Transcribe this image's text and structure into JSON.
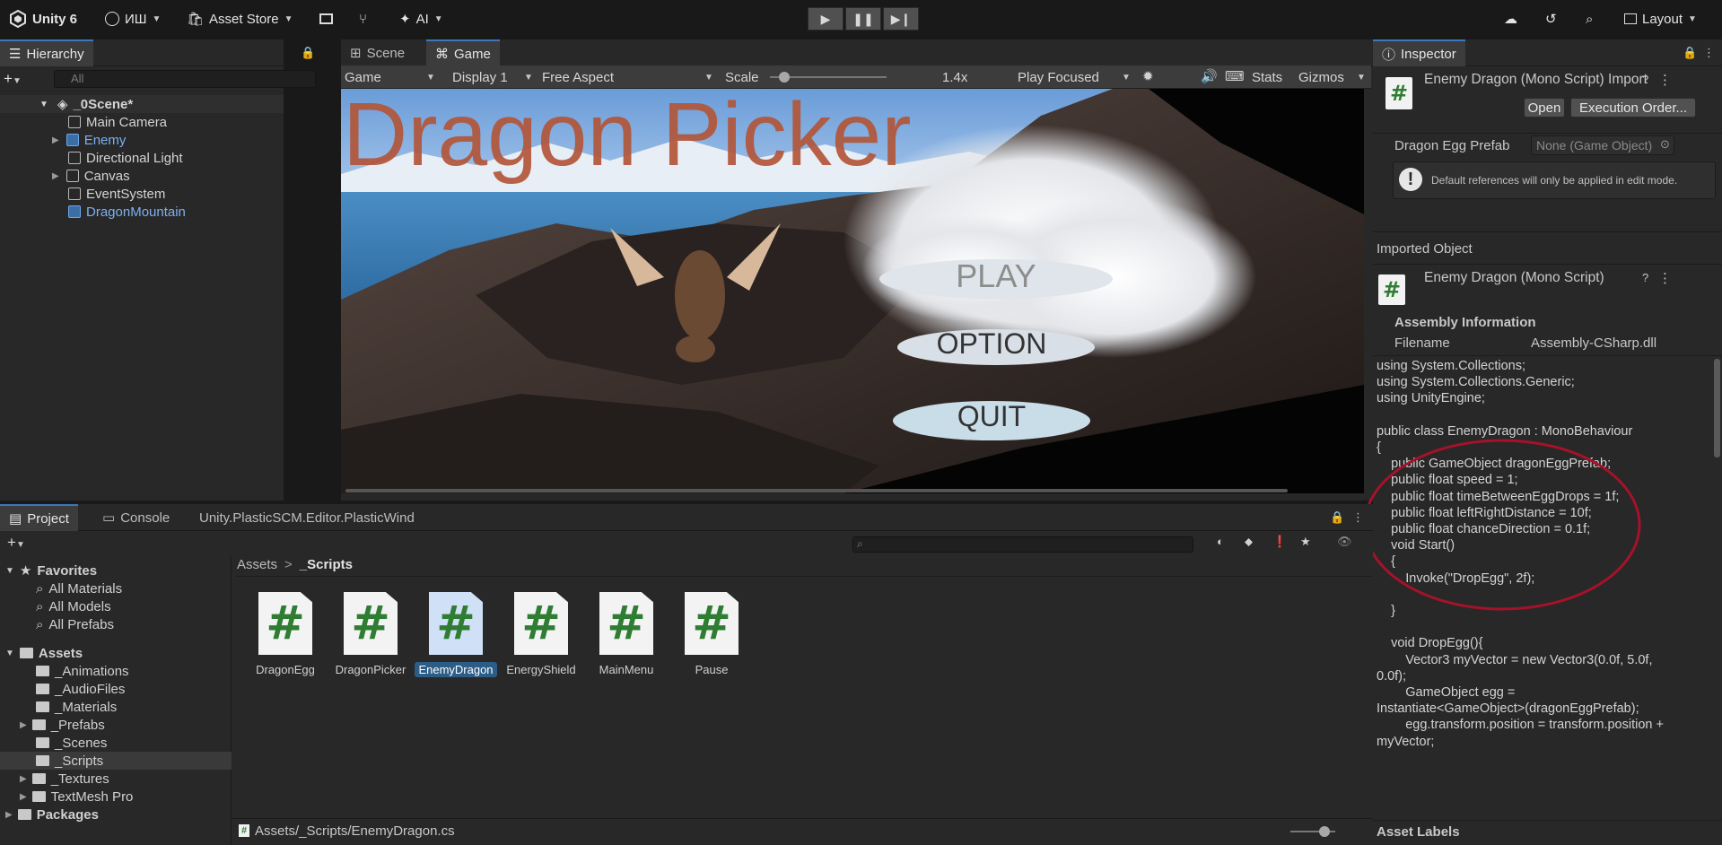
{
  "toolbar": {
    "app_label": "Unity 6",
    "account_label": "ИШ",
    "asset_store_label": "Asset Store",
    "ai_label": "AI",
    "layout_label": "Layout"
  },
  "hierarchy": {
    "tab_label": "Hierarchy",
    "search_placeholder": "All",
    "scene_name": "_0Scene*",
    "items": [
      {
        "label": "Main Camera",
        "prefab": false
      },
      {
        "label": "Enemy",
        "prefab": true
      },
      {
        "label": "Directional Light",
        "prefab": false
      },
      {
        "label": "Canvas",
        "prefab": false
      },
      {
        "label": "EventSystem",
        "prefab": false
      },
      {
        "label": "DragonMountain",
        "prefab": true
      }
    ]
  },
  "game_view": {
    "tabs": [
      "Scene",
      "Game"
    ],
    "mode": "Game",
    "display": "Display 1",
    "aspect": "Free Aspect",
    "scale_label": "Scale",
    "scale_value": "1.4x",
    "play_mode": "Play Focused",
    "stats_label": "Stats",
    "gizmos_label": "Gizmos",
    "game_title": "Dragon Picker",
    "menu_buttons": [
      "PLAY",
      "OPTION",
      "QUIT"
    ]
  },
  "inspector": {
    "tab_label": "Inspector",
    "header_title": "Enemy Dragon (Mono Script) Import",
    "open_button": "Open",
    "execution_order_button": "Execution Order...",
    "field_label": "Dragon Egg Prefab",
    "field_value": "None (Game Object)",
    "help_text": "Default references will only be applied in edit mode.",
    "imported_object_label": "Imported Object",
    "imported_title": "Enemy Dragon (Mono Script)",
    "assembly_header": "Assembly Information",
    "filename_label": "Filename",
    "filename_value": "Assembly-CSharp.dll",
    "code_lines": [
      "using System.Collections;",
      "using System.Collections.Generic;",
      "using UnityEngine;",
      "",
      "public class EnemyDragon : MonoBehaviour",
      "{",
      "    public GameObject dragonEggPrefab;",
      "    public float speed = 1;",
      "    public float timeBetweenEggDrops = 1f;",
      "    public float leftRightDistance = 10f;",
      "    public float chanceDirection = 0.1f;",
      "    void Start()",
      "    {",
      "        Invoke(\"DropEgg\", 2f);",
      "",
      "    }",
      "",
      "    void DropEgg(){",
      "        Vector3 myVector = new Vector3(0.0f, 5.0f,",
      "0.0f);",
      "        GameObject egg =",
      "Instantiate<GameObject>(dragonEggPrefab);",
      "        egg.transform.position = transform.position +",
      "myVector;"
    ],
    "asset_labels": "Asset Labels"
  },
  "project": {
    "tabs": [
      "Project",
      "Console",
      "Unity.PlasticSCM.Editor.PlasticWind"
    ],
    "favorites_label": "Favorites",
    "favorites": [
      "All Materials",
      "All Models",
      "All Prefabs"
    ],
    "assets_label": "Assets",
    "folders": [
      "_Animations",
      "_AudioFiles",
      "_Materials",
      "_Prefabs",
      "_Scenes",
      "_Scripts",
      "_Textures",
      "TextMesh Pro"
    ],
    "packages_label": "Packages",
    "breadcrumb_root": "Assets",
    "breadcrumb_current": "_Scripts",
    "files": [
      "DragonEgg",
      "DragonPicker",
      "EnemyDragon",
      "EnergyShield",
      "MainMenu",
      "Pause"
    ],
    "selected_file": "EnemyDragon",
    "status_path": "Assets/_Scripts/EnemyDragon.cs"
  },
  "colors": {
    "accent_blue": "#3a79bb",
    "prefab_blue": "#7cb0f0",
    "highlight_ring": "#a5122a",
    "title_orange": "#b2563a"
  }
}
